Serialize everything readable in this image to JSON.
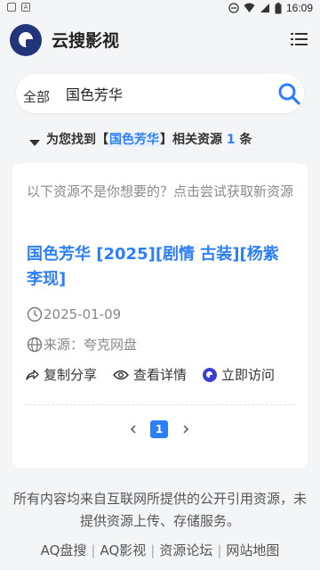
{
  "status_bar": {
    "time": "16:09"
  },
  "header": {
    "title": "云搜影视"
  },
  "search": {
    "category": "全部",
    "query": "国色芳华"
  },
  "result_summary": {
    "prefix": "为您找到【",
    "keyword": "国色芳华",
    "middle": "】相关资源 ",
    "count": "1",
    "suffix": " 条"
  },
  "card": {
    "notice": "以下资源不是你想要的？点击尝试获取新资源",
    "title": "国色芳华 [2025][剧情 古装][杨紫 李现]",
    "date": "2025-01-09",
    "source": "来源：夸克网盘",
    "actions": {
      "share": "复制分享",
      "details": "查看详情",
      "visit": "立即访问"
    },
    "pagination": {
      "current": "1"
    }
  },
  "footer": {
    "text": "所有内容均来自互联网所提供的公开引用资源，未提供资源上传、存储服务。",
    "links": [
      "AQ盘搜",
      "AQ影视",
      "资源论坛",
      "网站地图"
    ]
  },
  "colors": {
    "accent": "#2d7ff9",
    "logo": "#22357a"
  }
}
